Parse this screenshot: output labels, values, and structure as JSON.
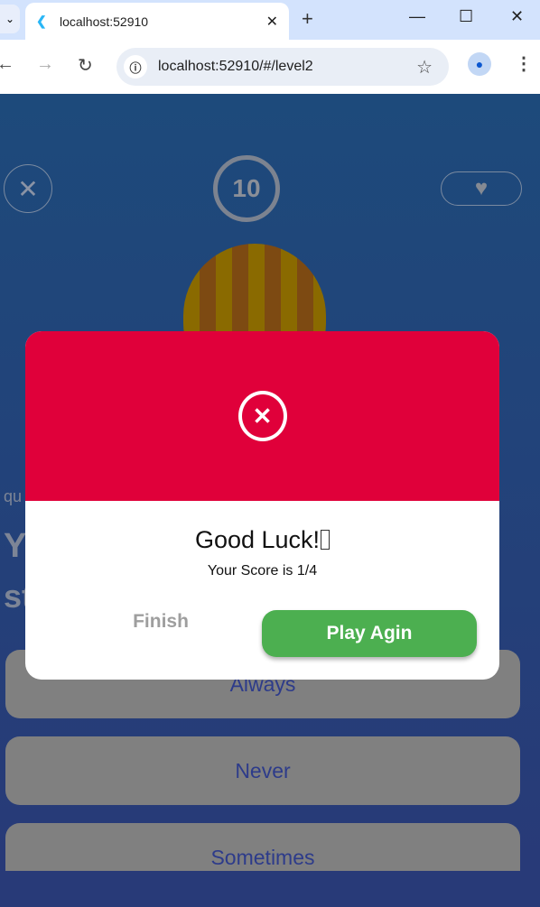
{
  "browser": {
    "tab_title": "localhost:52910",
    "url": "localhost:52910/#/level2"
  },
  "game": {
    "timer": "10",
    "question_fragments": [
      "qu",
      "Y",
      "st"
    ],
    "answers": [
      "Always",
      "Never",
      "Sometimes"
    ]
  },
  "dialog": {
    "title": "Good Luck!",
    "score": "Your Score is 1/4",
    "finish_label": "Finish",
    "play_again_label": "Play Agin",
    "header_color": "#e0003a",
    "button_color": "#4caf50"
  }
}
